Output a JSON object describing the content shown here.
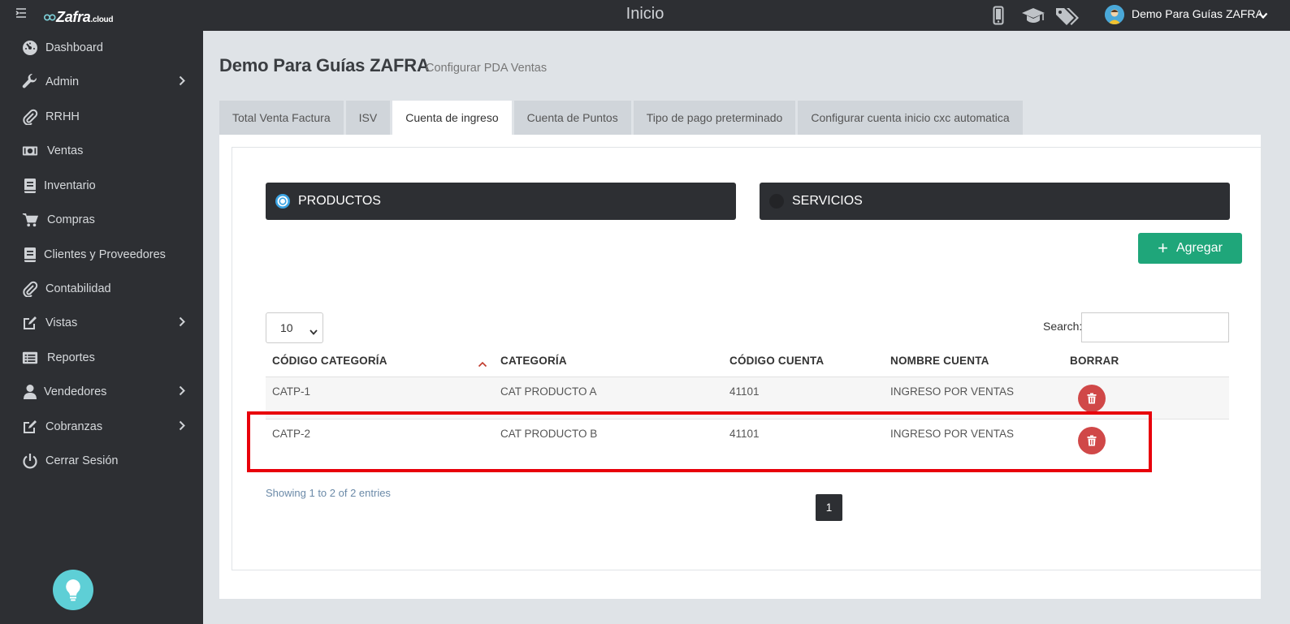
{
  "topbar": {
    "logo_text": "Zafra",
    "logo_suffix": ".cloud",
    "title": "Inicio",
    "user_name": "Demo Para Guías ZAFRA",
    "icons": [
      "mobile-icon",
      "graduation-cap-icon",
      "tags-icon",
      "user-avatar"
    ]
  },
  "sidebar": {
    "items": [
      {
        "label": "Dashboard",
        "icon": "dashboard-icon",
        "has_submenu": false
      },
      {
        "label": "Admin",
        "icon": "wrench-icon",
        "has_submenu": true
      },
      {
        "label": "RRHH",
        "icon": "paperclip-icon",
        "has_submenu": false
      },
      {
        "label": "Ventas",
        "icon": "money-icon",
        "has_submenu": false
      },
      {
        "label": "Inventario",
        "icon": "book-icon",
        "has_submenu": false
      },
      {
        "label": "Compras",
        "icon": "cart-icon",
        "has_submenu": false
      },
      {
        "label": "Clientes y Proveedores",
        "icon": "book-icon",
        "has_submenu": false
      },
      {
        "label": "Contabilidad",
        "icon": "paperclip-icon",
        "has_submenu": false
      },
      {
        "label": "Vistas",
        "icon": "edit-icon",
        "has_submenu": true
      },
      {
        "label": "Reportes",
        "icon": "list-icon",
        "has_submenu": false
      },
      {
        "label": "Vendedores",
        "icon": "user-icon",
        "has_submenu": true
      },
      {
        "label": "Cobranzas",
        "icon": "edit-icon",
        "has_submenu": true
      },
      {
        "label": "Cerrar Sesión",
        "icon": "power-icon",
        "has_submenu": false
      }
    ]
  },
  "page": {
    "title": "Demo Para Guías ZAFRA",
    "subtitle": "Configurar PDA Ventas"
  },
  "tabs": [
    {
      "label": "Total Venta Factura",
      "active": false
    },
    {
      "label": "ISV",
      "active": false
    },
    {
      "label": "Cuenta de ingreso",
      "active": true
    },
    {
      "label": "Cuenta de Puntos",
      "active": false
    },
    {
      "label": "Tipo de pago preterminado",
      "active": false
    },
    {
      "label": "Configurar cuenta inicio cxc automatica",
      "active": false
    }
  ],
  "options": {
    "productos": {
      "label": "PRODUCTOS",
      "selected": true
    },
    "servicios": {
      "label": "SERVICIOS",
      "selected": false
    }
  },
  "add_button": {
    "label": "Agregar"
  },
  "table_controls": {
    "page_length": "10",
    "search_label": "Search:",
    "search_value": ""
  },
  "table": {
    "columns": [
      "CÓDIGO CATEGORÍA",
      "CATEGORÍA",
      "CÓDIGO CUENTA",
      "NOMBRE CUENTA",
      "BORRAR"
    ],
    "rows": [
      {
        "codigo_categoria": "CATP-1",
        "categoria": "CAT PRODUCTO A",
        "codigo_cuenta": "41101",
        "nombre_cuenta": "INGRESO POR VENTAS"
      },
      {
        "codigo_categoria": "CATP-2",
        "categoria": "CAT PRODUCTO B",
        "codigo_cuenta": "41101",
        "nombre_cuenta": "INGRESO POR VENTAS"
      }
    ],
    "info": "Showing 1 to 2 of 2 entries",
    "current_page": "1"
  },
  "colors": {
    "dark": "#2d2f33",
    "accent_green": "#1fa67a",
    "delete_red": "#d04848",
    "radio_selected": "#3aa3e3",
    "highlight": "#e8000b"
  }
}
